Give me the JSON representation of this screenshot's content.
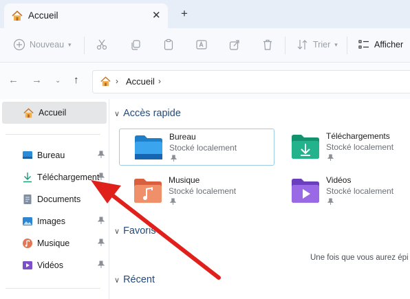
{
  "tab": {
    "title": "Accueil",
    "close": "✕",
    "new_tab": "+"
  },
  "toolbar": {
    "new_label": "Nouveau",
    "sort_label": "Trier",
    "view_label": "Afficher"
  },
  "address": {
    "crumb": "Accueil",
    "sep1": "›",
    "sep2": "›"
  },
  "sidebar": {
    "home": "Accueil",
    "items": [
      {
        "label": "Bureau",
        "icon": "desktop-icon",
        "pinned": true
      },
      {
        "label": "Téléchargement",
        "icon": "download-icon",
        "pinned": true
      },
      {
        "label": "Documents",
        "icon": "documents-icon",
        "pinned": false
      },
      {
        "label": "Images",
        "icon": "images-icon",
        "pinned": true
      },
      {
        "label": "Musique",
        "icon": "music-icon",
        "pinned": true
      },
      {
        "label": "Vidéos",
        "icon": "videos-icon",
        "pinned": true
      }
    ]
  },
  "main": {
    "quick_access": "Accès rapide",
    "favorites": "Favoris",
    "recent": "Récent",
    "folders": [
      {
        "name": "Bureau",
        "status": "Stocké localement",
        "icon": "desktop-folder-icon"
      },
      {
        "name": "Téléchargements",
        "status": "Stocké localement",
        "icon": "downloads-folder-icon"
      },
      {
        "name": "Musique",
        "status": "Stocké localement",
        "icon": "music-folder-icon"
      },
      {
        "name": "Vidéos",
        "status": "Stocké localement",
        "icon": "videos-folder-icon"
      }
    ],
    "favorites_hint": "Une fois que vous aurez épi"
  },
  "colors": {
    "accent": "#0067c0",
    "arrow": "#e0201b",
    "section_text": "#244a7a"
  }
}
